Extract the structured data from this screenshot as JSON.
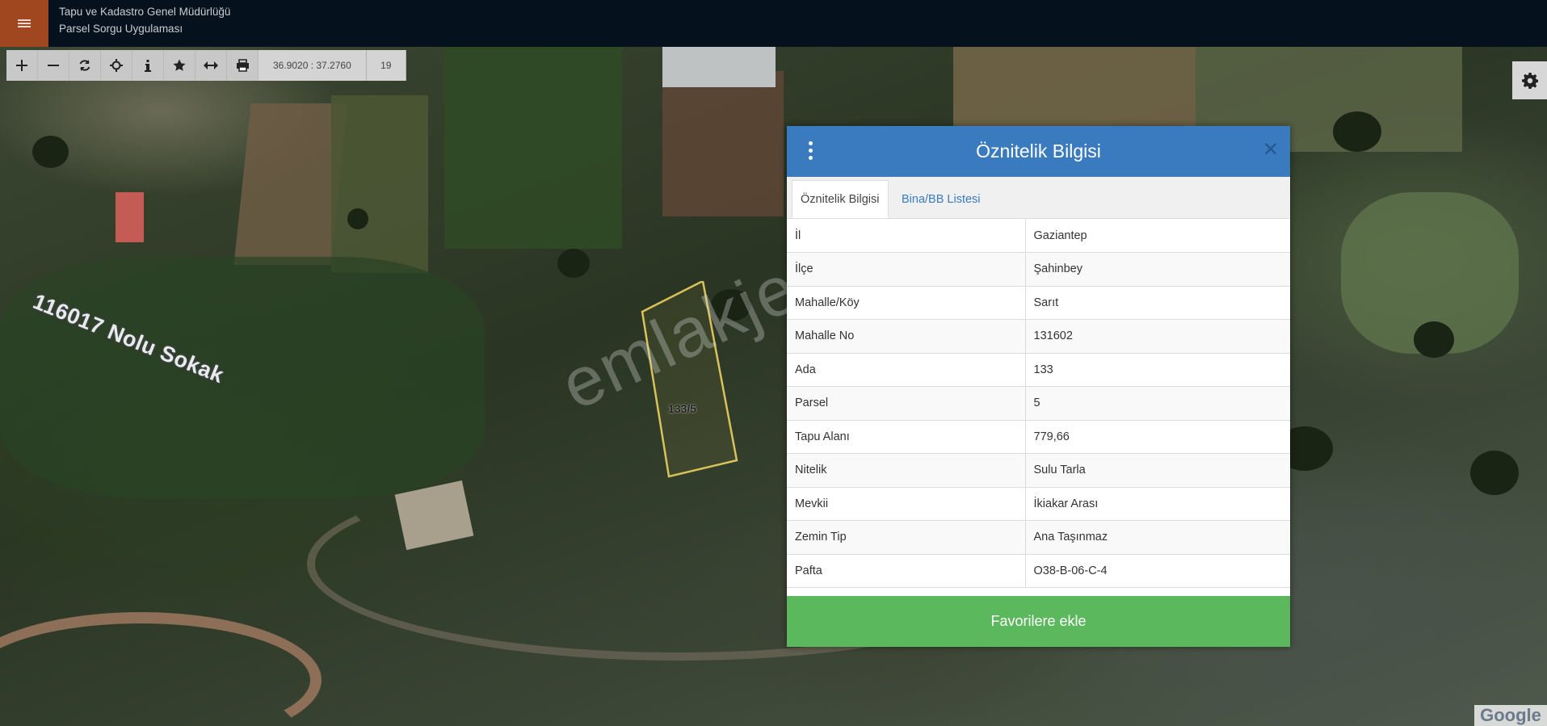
{
  "header": {
    "org_name": "Tapu ve Kadastro Genel Müdürlüğü",
    "app_name": "Parsel Sorgu Uygulaması",
    "menu_icon": "hamburger-menu-icon"
  },
  "toolbar": {
    "tools": [
      {
        "name": "zoom-in-icon",
        "title": "plus"
      },
      {
        "name": "zoom-out-icon",
        "title": "minus"
      },
      {
        "name": "refresh-icon",
        "title": "refresh"
      },
      {
        "name": "locate-icon",
        "title": "crosshair"
      },
      {
        "name": "info-icon",
        "title": "info"
      },
      {
        "name": "favorite-star-icon",
        "title": "star"
      },
      {
        "name": "measure-icon",
        "title": "arrows-horizontal"
      },
      {
        "name": "print-icon",
        "title": "print"
      }
    ],
    "coordinates": "36.9020 : 37.2760",
    "zoom_level": "19"
  },
  "map": {
    "street_label": "116017 Nolu Sokak",
    "parcel_label": "133/5",
    "watermark": "emlakjet.com",
    "provider_logo": "Google"
  },
  "modal": {
    "title": "Öznitelik Bilgisi",
    "tabs": [
      {
        "label": "Öznitelik Bilgisi",
        "active": true
      },
      {
        "label": "Bina/BB Listesi",
        "active": false
      }
    ],
    "rows": [
      {
        "key": "İl",
        "value": "Gaziantep"
      },
      {
        "key": "İlçe",
        "value": "Şahinbey"
      },
      {
        "key": "Mahalle/Köy",
        "value": "Sarıt"
      },
      {
        "key": "Mahalle No",
        "value": "131602"
      },
      {
        "key": "Ada",
        "value": "133"
      },
      {
        "key": "Parsel",
        "value": "5"
      },
      {
        "key": "Tapu Alanı",
        "value": "779,66"
      },
      {
        "key": "Nitelik",
        "value": "Sulu Tarla"
      },
      {
        "key": "Mevkii",
        "value": "İkiakar Arası"
      },
      {
        "key": "Zemin Tip",
        "value": "Ana Taşınmaz"
      },
      {
        "key": "Pafta",
        "value": "O38-B-06-C-4"
      }
    ],
    "favorite_button": "Favorilere ekle"
  },
  "colors": {
    "topbar_bg": "#05111c",
    "menu_button_bg": "#a0471f",
    "modal_header_bg": "#3a7bbf",
    "favorite_button_bg": "#5cb85c",
    "parcel_outline": "#d8c25a"
  }
}
